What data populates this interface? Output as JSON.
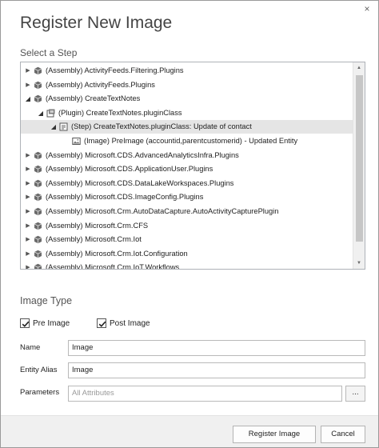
{
  "dialog": {
    "title": "Register New Image",
    "close_glyph": "×"
  },
  "step_section": {
    "label": "Select a Step",
    "tree": [
      {
        "label": "(Assembly) ActivityFeeds.Filtering.Plugins",
        "level": 0,
        "expander": "collapsed",
        "icon": "assembly-icon"
      },
      {
        "label": "(Assembly) ActivityFeeds.Plugins",
        "level": 0,
        "expander": "collapsed",
        "icon": "assembly-icon"
      },
      {
        "label": "(Assembly) CreateTextNotes",
        "level": 0,
        "expander": "expanded",
        "icon": "assembly-icon"
      },
      {
        "label": "(Plugin) CreateTextNotes.pluginClass",
        "level": 1,
        "expander": "expanded",
        "icon": "plugin-icon"
      },
      {
        "label": "(Step) CreateTextNotes.pluginClass: Update of contact",
        "level": 2,
        "expander": "expanded",
        "icon": "step-icon",
        "selected": true
      },
      {
        "label": "(Image) PreImage (accountid,parentcustomerid) - Updated Entity",
        "level": 3,
        "expander": "none",
        "icon": "image-icon"
      },
      {
        "label": "(Assembly) Microsoft.CDS.AdvancedAnalyticsInfra.Plugins",
        "level": 0,
        "expander": "collapsed",
        "icon": "assembly-icon"
      },
      {
        "label": "(Assembly) Microsoft.CDS.ApplicationUser.Plugins",
        "level": 0,
        "expander": "collapsed",
        "icon": "assembly-icon"
      },
      {
        "label": "(Assembly) Microsoft.CDS.DataLakeWorkspaces.Plugins",
        "level": 0,
        "expander": "collapsed",
        "icon": "assembly-icon"
      },
      {
        "label": "(Assembly) Microsoft.CDS.ImageConfig.Plugins",
        "level": 0,
        "expander": "collapsed",
        "icon": "assembly-icon"
      },
      {
        "label": "(Assembly) Microsoft.Crm.AutoDataCapture.AutoActivityCapturePlugin",
        "level": 0,
        "expander": "collapsed",
        "icon": "assembly-icon"
      },
      {
        "label": "(Assembly) Microsoft.Crm.CFS",
        "level": 0,
        "expander": "collapsed",
        "icon": "assembly-icon"
      },
      {
        "label": "(Assembly) Microsoft.Crm.Iot",
        "level": 0,
        "expander": "collapsed",
        "icon": "assembly-icon"
      },
      {
        "label": "(Assembly) Microsoft.Crm.Iot.Configuration",
        "level": 0,
        "expander": "collapsed",
        "icon": "assembly-icon"
      },
      {
        "label": "(Assembly) Microsoft.Crm.IoT.Workflows",
        "level": 0,
        "expander": "collapsed",
        "icon": "assembly-icon"
      }
    ],
    "scroll_up_glyph": "▲",
    "scroll_down_glyph": "▼"
  },
  "image_type": {
    "label": "Image Type",
    "pre_image": {
      "label": "Pre Image",
      "checked": true
    },
    "post_image": {
      "label": "Post Image",
      "checked": true
    }
  },
  "fields": {
    "name": {
      "label": "Name",
      "value": "Image"
    },
    "entity_alias": {
      "label": "Entity Alias",
      "value": "Image"
    },
    "parameters": {
      "label": "Parameters",
      "placeholder": "All Attributes",
      "button_label": "..."
    }
  },
  "footer": {
    "register_label": "Register Image",
    "cancel_label": "Cancel"
  },
  "colors": {
    "selected_row": "#e5e5e5",
    "footer_bg": "#f0f0f0"
  }
}
